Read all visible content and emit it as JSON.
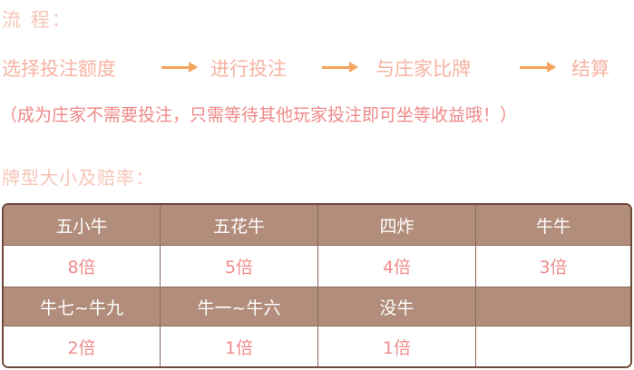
{
  "flow": {
    "title": "流 程：",
    "steps": [
      "选择投注额度",
      "进行投注",
      "与庄家比牌",
      "结算"
    ],
    "note": "（成为庄家不需要投注，只需等待其他玩家投注即可坐等收益哦！）"
  },
  "odds": {
    "title": "牌型大小及赔率：",
    "rows": [
      {
        "hands": [
          "五小牛",
          "五花牛",
          "四炸",
          "牛牛"
        ],
        "multipliers": [
          "8倍",
          "5倍",
          "4倍",
          "3倍"
        ]
      },
      {
        "hands": [
          "牛七~牛九",
          "牛一~牛六",
          "没牛",
          ""
        ],
        "multipliers": [
          "2倍",
          "1倍",
          "1倍",
          ""
        ]
      }
    ]
  },
  "colors": {
    "title_peach": "#f6c5b7",
    "step_salmon": "#f7b3a2",
    "arrow_orange": "#f5a55e",
    "note_pink": "#f08a8a",
    "header_brown": "#b28d7c",
    "border_brown": "#6d4a3c",
    "value_pink": "#f08c8c"
  }
}
